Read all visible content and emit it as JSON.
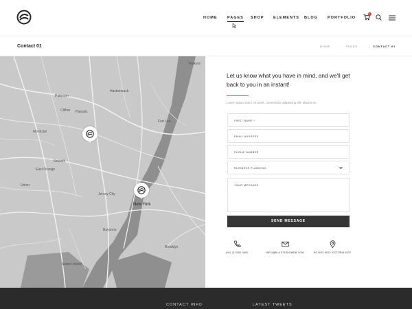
{
  "nav": {
    "items": [
      "HOME",
      "PAGES",
      "SHOP",
      "ELEMENTS",
      "BLOG",
      "PORTFOLIO"
    ],
    "cart_count": "1"
  },
  "page": {
    "title": "Contact 01",
    "breadcrumbs": [
      "HOME",
      "PAGES",
      "CONTACT 01"
    ]
  },
  "map": {
    "labels": [
      "Yonkers",
      "Hackensack",
      "Clifton",
      "Passaic",
      "Fort Lee",
      "Paterson",
      "Montclair",
      "Newark",
      "East Orange",
      "Jersey City",
      "Union",
      "Staten Island",
      "Bayonne",
      "Brooklyn",
      "New York"
    ]
  },
  "contact": {
    "heading": "Let us know what you have in mind, and we'll get back to you in an instant!",
    "sub": "Lorem ipsum dolor sit amet, consectetur adipiscing elit. Mauris eu",
    "fields": {
      "first_name": "FIRST NAME *",
      "email": "EMAIL ADDRESS",
      "phone": "PHONE NUMBER",
      "planning": "BUSINESS PLANNING",
      "message": "YOUR MESSAGE"
    },
    "send": "SEND MESSAGE",
    "info": {
      "phone": "(+61 2) 9281 9000",
      "email": "INFO@BLA STUDIOWEB.COM",
      "address": "PO BOX 9022 VICTORIA 9037"
    }
  },
  "footer": {
    "contact_info": "CONTACT INFO",
    "tweets": "LATEST TWEETS"
  },
  "colors": {
    "accent": "#5b7bd5",
    "button": "#363636",
    "footer": "#2b2b2b",
    "badge": "#e53935"
  }
}
